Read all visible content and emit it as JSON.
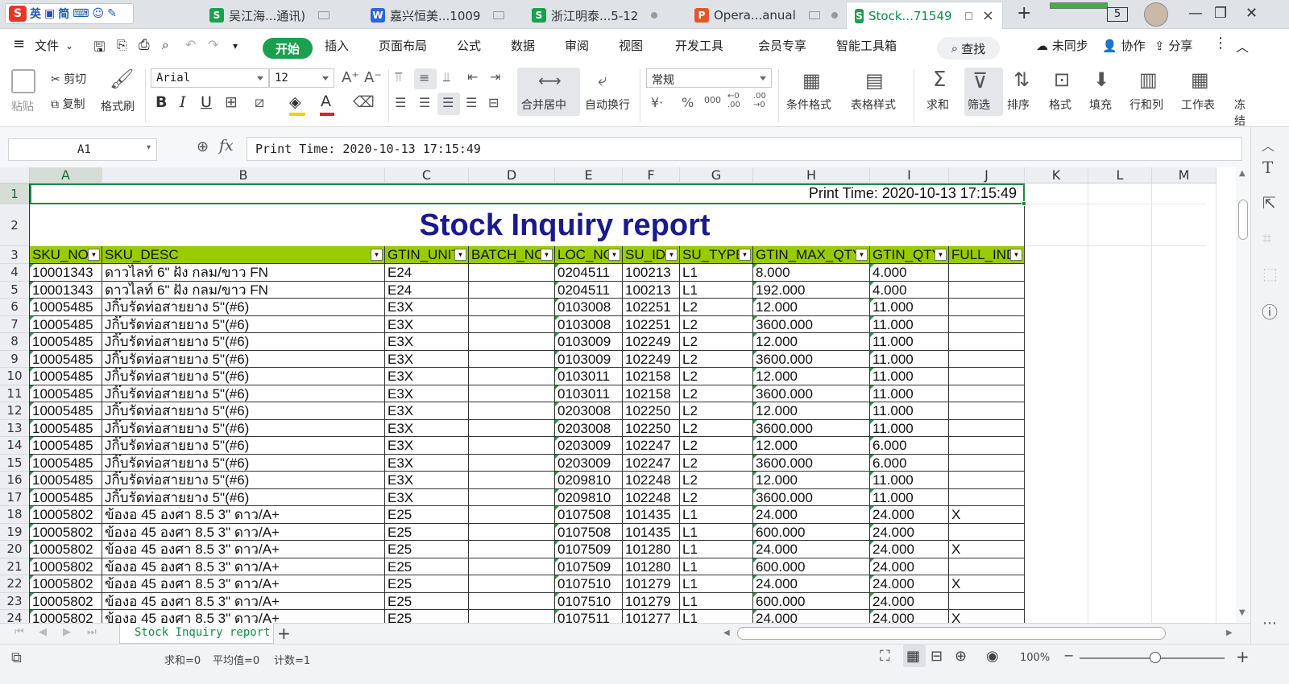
{
  "ime": {
    "logo": "S",
    "items": [
      "英",
      "简"
    ]
  },
  "tabs": [
    {
      "label": "吴江海...通讯)",
      "icon": "S",
      "color": "#1aa04f"
    },
    {
      "label": "嘉兴恒美...1009",
      "icon": "W",
      "color": "#2b66d9"
    },
    {
      "label": "浙江明泰...5-12",
      "icon": "S",
      "color": "#1aa04f"
    },
    {
      "label": "Opera...anual",
      "icon": "P",
      "color": "#e2562b"
    },
    {
      "label": "Stock...71549",
      "icon": "S",
      "color": "#1aa04f"
    }
  ],
  "tab_counter": "5",
  "menu": {
    "file": "文件",
    "items": [
      "开始",
      "插入",
      "页面布局",
      "公式",
      "数据",
      "审阅",
      "视图",
      "开发工具",
      "会员专享",
      "智能工具箱"
    ],
    "search": "查找",
    "right": [
      "未同步",
      "协作",
      "分享"
    ]
  },
  "ribbon": {
    "paste": "粘贴",
    "cut": "剪切",
    "copy": "复制",
    "format_painter": "格式刷",
    "font_name": "Arial",
    "font_size": "12",
    "merge_center": "合并居中",
    "wrap_text": "自动换行",
    "number_format": "常规",
    "cond_format": "条件格式",
    "table_style": "表格样式",
    "sum": "求和",
    "filter": "筛选",
    "sort": "排序",
    "format": "格式",
    "fill": "填充",
    "rows_cols": "行和列",
    "worksheet": "工作表",
    "freeze": "冻结"
  },
  "namebox": "A1",
  "formula": "Print Time: 2020-10-13 17:15:49",
  "columns": [
    "A",
    "B",
    "C",
    "D",
    "E",
    "F",
    "G",
    "H",
    "I",
    "J",
    "K",
    "L",
    "M"
  ],
  "print_time": "Print Time: 2020-10-13 17:15:49",
  "report_title": "Stock Inquiry report",
  "headers": [
    "SKU_NO",
    "SKU_DESC",
    "GTIN_UNIT",
    "BATCH_NO",
    "LOC_NO",
    "SU_ID",
    "SU_TYPE",
    "GTIN_MAX_QTY",
    "GTIN_QTY",
    "FULL_IND"
  ],
  "rows": [
    [
      "10001343",
      "ดาวไลท์ 6\" ฝัง กลม/ขาว FN",
      "E24",
      "",
      "0204511",
      "100213",
      "L1",
      "8.000",
      "4.000",
      ""
    ],
    [
      "10001343",
      "ดาวไลท์ 6\" ฝัง กลม/ขาว FN",
      "E24",
      "",
      "0204511",
      "100213",
      "L1",
      "192.000",
      "4.000",
      ""
    ],
    [
      "10005485",
      "Jกิ๊บรัดท่อสายยาง 5\"(#6)",
      "E3X",
      "",
      "0103008",
      "102251",
      "L2",
      "12.000",
      "11.000",
      ""
    ],
    [
      "10005485",
      "Jกิ๊บรัดท่อสายยาง 5\"(#6)",
      "E3X",
      "",
      "0103008",
      "102251",
      "L2",
      "3600.000",
      "11.000",
      ""
    ],
    [
      "10005485",
      "Jกิ๊บรัดท่อสายยาง 5\"(#6)",
      "E3X",
      "",
      "0103009",
      "102249",
      "L2",
      "12.000",
      "11.000",
      ""
    ],
    [
      "10005485",
      "Jกิ๊บรัดท่อสายยาง 5\"(#6)",
      "E3X",
      "",
      "0103009",
      "102249",
      "L2",
      "3600.000",
      "11.000",
      ""
    ],
    [
      "10005485",
      "Jกิ๊บรัดท่อสายยาง 5\"(#6)",
      "E3X",
      "",
      "0103011",
      "102158",
      "L2",
      "12.000",
      "11.000",
      ""
    ],
    [
      "10005485",
      "Jกิ๊บรัดท่อสายยาง 5\"(#6)",
      "E3X",
      "",
      "0103011",
      "102158",
      "L2",
      "3600.000",
      "11.000",
      ""
    ],
    [
      "10005485",
      "Jกิ๊บรัดท่อสายยาง 5\"(#6)",
      "E3X",
      "",
      "0203008",
      "102250",
      "L2",
      "12.000",
      "11.000",
      ""
    ],
    [
      "10005485",
      "Jกิ๊บรัดท่อสายยาง 5\"(#6)",
      "E3X",
      "",
      "0203008",
      "102250",
      "L2",
      "3600.000",
      "11.000",
      ""
    ],
    [
      "10005485",
      "Jกิ๊บรัดท่อสายยาง 5\"(#6)",
      "E3X",
      "",
      "0203009",
      "102247",
      "L2",
      "12.000",
      "6.000",
      ""
    ],
    [
      "10005485",
      "Jกิ๊บรัดท่อสายยาง 5\"(#6)",
      "E3X",
      "",
      "0203009",
      "102247",
      "L2",
      "3600.000",
      "6.000",
      ""
    ],
    [
      "10005485",
      "Jกิ๊บรัดท่อสายยาง 5\"(#6)",
      "E3X",
      "",
      "0209810",
      "102248",
      "L2",
      "12.000",
      "11.000",
      ""
    ],
    [
      "10005485",
      "Jกิ๊บรัดท่อสายยาง 5\"(#6)",
      "E3X",
      "",
      "0209810",
      "102248",
      "L2",
      "3600.000",
      "11.000",
      ""
    ],
    [
      "10005802",
      "ข้องอ 45 องศา 8.5 3\" ดาว/A+",
      "E25",
      "",
      "0107508",
      "101435",
      "L1",
      "24.000",
      "24.000",
      "X"
    ],
    [
      "10005802",
      "ข้องอ 45 องศา 8.5 3\" ดาว/A+",
      "E25",
      "",
      "0107508",
      "101435",
      "L1",
      "600.000",
      "24.000",
      ""
    ],
    [
      "10005802",
      "ข้องอ 45 องศา 8.5 3\" ดาว/A+",
      "E25",
      "",
      "0107509",
      "101280",
      "L1",
      "24.000",
      "24.000",
      "X"
    ],
    [
      "10005802",
      "ข้องอ 45 องศา 8.5 3\" ดาว/A+",
      "E25",
      "",
      "0107509",
      "101280",
      "L1",
      "600.000",
      "24.000",
      ""
    ],
    [
      "10005802",
      "ข้องอ 45 องศา 8.5 3\" ดาว/A+",
      "E25",
      "",
      "0107510",
      "101279",
      "L1",
      "24.000",
      "24.000",
      "X"
    ],
    [
      "10005802",
      "ข้องอ 45 องศา 8.5 3\" ดาว/A+",
      "E25",
      "",
      "0107510",
      "101279",
      "L1",
      "600.000",
      "24.000",
      ""
    ],
    [
      "10005802",
      "ข้องอ 45 องศา 8.5 3\" ดาว/A+",
      "E25",
      "",
      "0107511",
      "101277",
      "L1",
      "24.000",
      "24.000",
      "X"
    ]
  ],
  "sheet_tab": "Stock Inquiry report",
  "status": {
    "sum": "求和=0",
    "avg": "平均值=0",
    "count": "计数=1",
    "zoom": "100%"
  },
  "colors": {
    "accent": "#1aa04f",
    "header_fill": "#99cc00",
    "title_color": "#1a1a8c",
    "selection": "#1f8a45"
  }
}
